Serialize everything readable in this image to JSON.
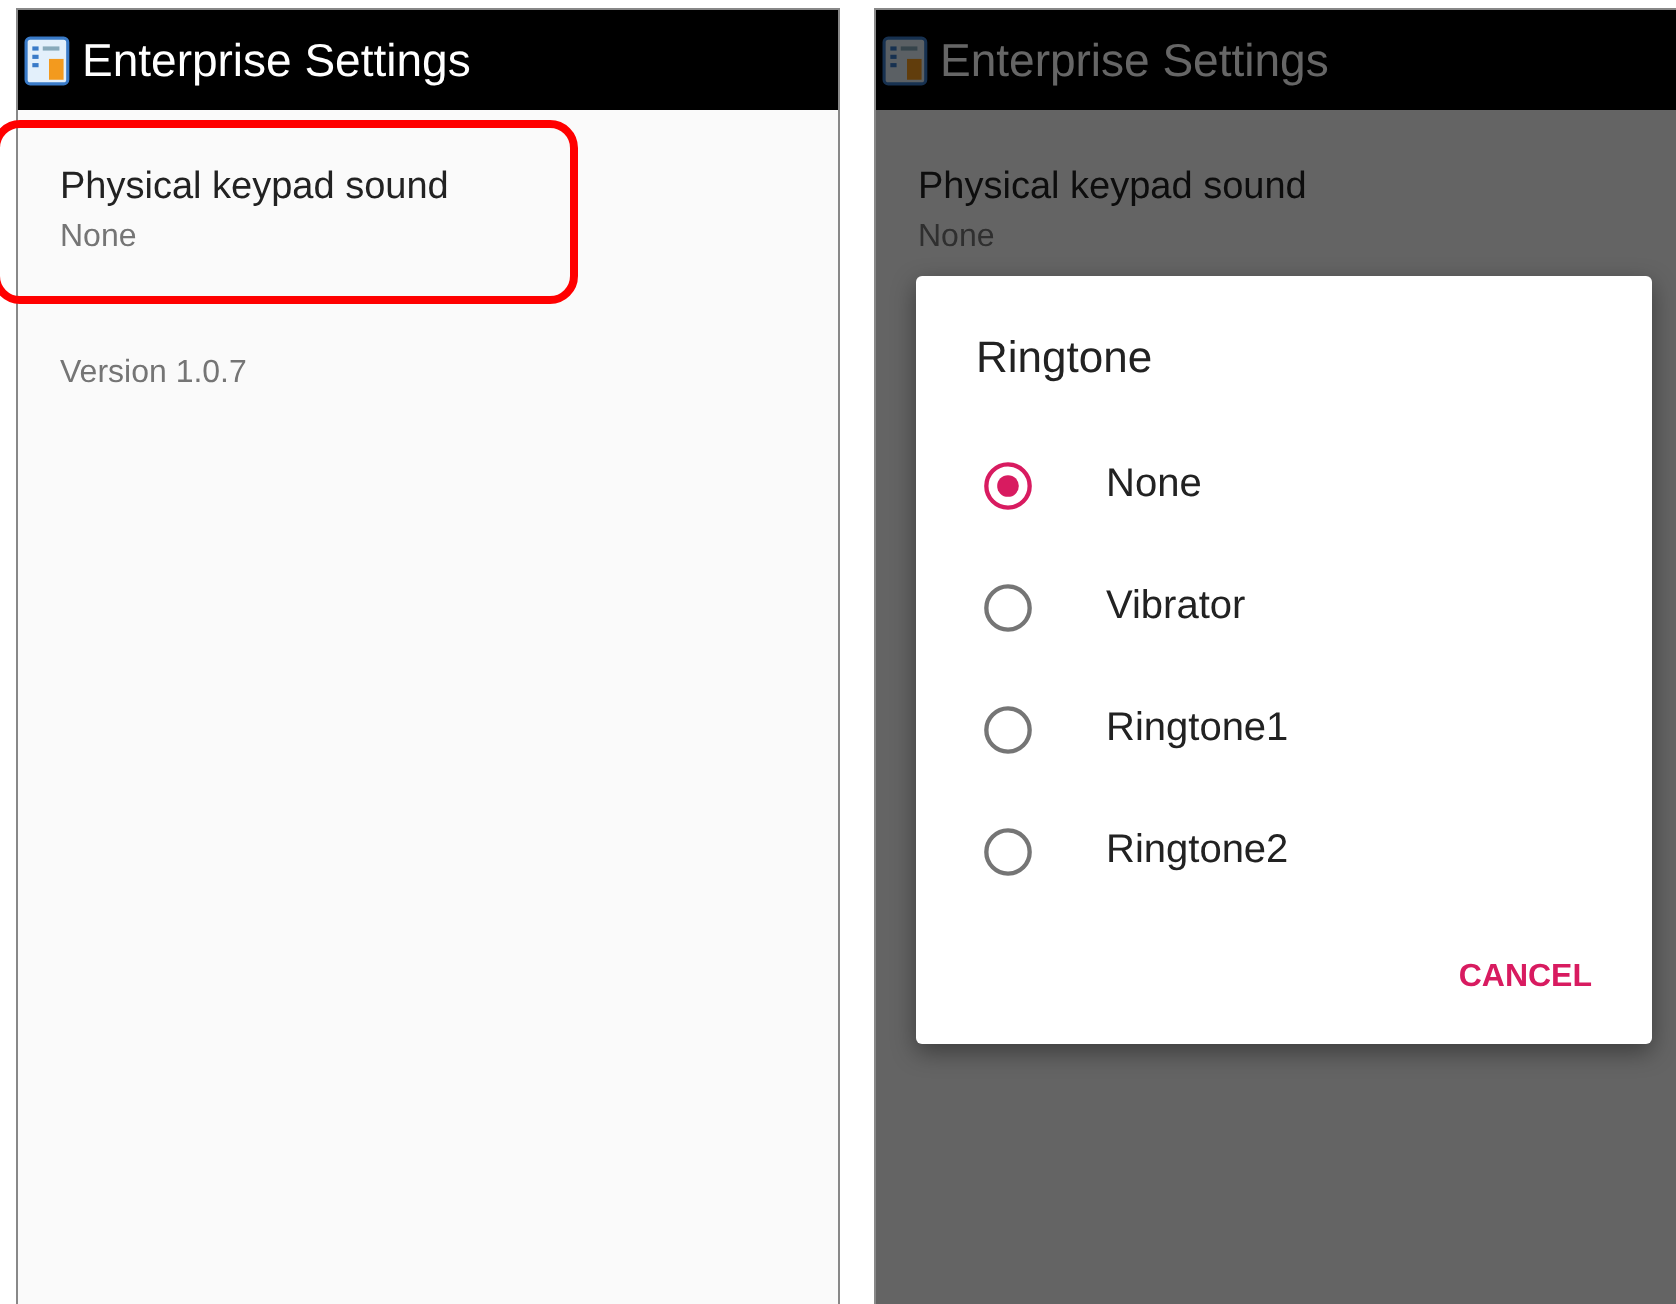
{
  "screens": [
    {
      "title": "Enterprise Settings",
      "dimmed": false,
      "preferences": [
        {
          "title": "Physical keypad sound",
          "summary": "None",
          "highlighted": true
        }
      ],
      "version": "Version 1.0.7"
    },
    {
      "title": "Enterprise Settings",
      "dimmed": true,
      "preferences": [
        {
          "title": "Physical keypad sound",
          "summary": "None",
          "highlighted": false
        }
      ],
      "dialog": {
        "title": "Ringtone",
        "options": [
          {
            "label": "None",
            "selected": true
          },
          {
            "label": "Vibrator",
            "selected": false
          },
          {
            "label": "Ringtone1",
            "selected": false
          },
          {
            "label": "Ringtone2",
            "selected": false
          }
        ],
        "buttons": [
          "CANCEL"
        ]
      }
    }
  ]
}
